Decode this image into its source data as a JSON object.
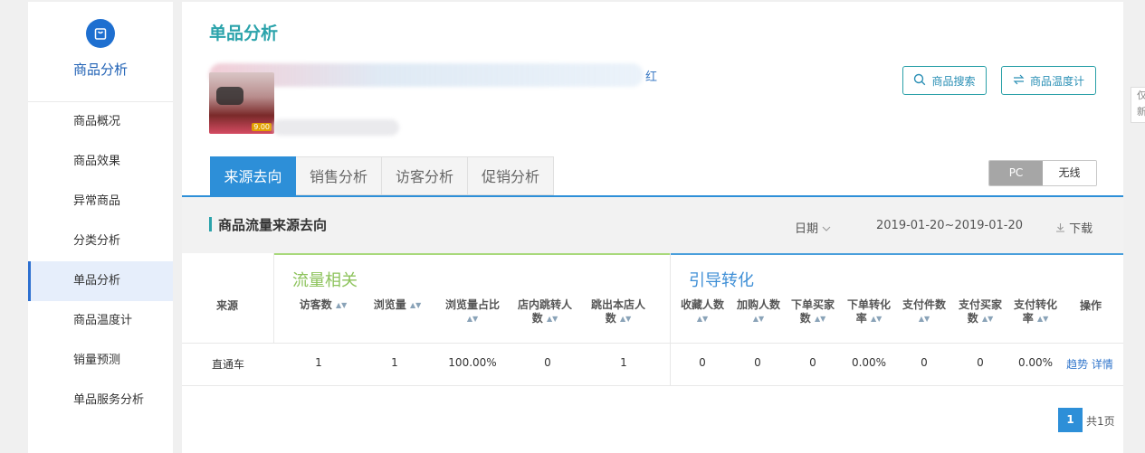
{
  "sidebar": {
    "title": "商品分析",
    "items": [
      {
        "label": "商品概况"
      },
      {
        "label": "商品效果"
      },
      {
        "label": "异常商品"
      },
      {
        "label": "分类分析"
      },
      {
        "label": "单品分析"
      },
      {
        "label": "商品温度计"
      },
      {
        "label": "销量预测"
      },
      {
        "label": "单品服务分析"
      }
    ],
    "active_index": 4
  },
  "main": {
    "title": "单品分析",
    "product": {
      "name_tail": "红",
      "price": "9.00"
    },
    "buttons": {
      "search": "商品搜索",
      "thermometer": "商品温度计"
    },
    "tabs": [
      "来源去向",
      "销售分析",
      "访客分析",
      "促销分析"
    ],
    "device": [
      "PC",
      "无线"
    ],
    "section": {
      "title": "商品流量来源去向",
      "date_label": "日期",
      "date_range": "2019-01-20~2019-01-20",
      "download": "下载"
    },
    "table": {
      "source_header": "来源",
      "group_a": "流量相关",
      "group_b": "引导转化",
      "headers": {
        "visitors": "访客数",
        "pageviews": "浏览量",
        "pv_ratio": "浏览量占比",
        "jump_in_store": "店内跳转人数",
        "exit_store": "跳出本店人数",
        "favorites": "收藏人数",
        "add_cart": "加购人数",
        "buyers_ordered": "下单买家数",
        "order_conv": "下单转化率",
        "paid_items": "支付件数",
        "paid_buyers": "支付买家数",
        "pay_conv": "支付转化率",
        "actions": "操作"
      },
      "row": {
        "source": "直通车",
        "visitors": "1",
        "pageviews": "1",
        "pv_ratio": "100.00%",
        "jump_in_store": "0",
        "exit_store": "1",
        "favorites": "0",
        "add_cart": "0",
        "buyers_ordered": "0",
        "order_conv": "0.00%",
        "paid_items": "0",
        "paid_buyers": "0",
        "pay_conv": "0.00%",
        "trend": "趋势",
        "detail": "详情"
      }
    },
    "pager": {
      "current": "1",
      "total": "共1页"
    }
  },
  "right_edge": {
    "chars": [
      "仅",
      "新"
    ]
  },
  "colors": {
    "brand_teal": "#2ba3ab",
    "brand_blue": "#2d8fd8",
    "group_green": "#8dc35c",
    "group_blue": "#3f8fd6"
  }
}
